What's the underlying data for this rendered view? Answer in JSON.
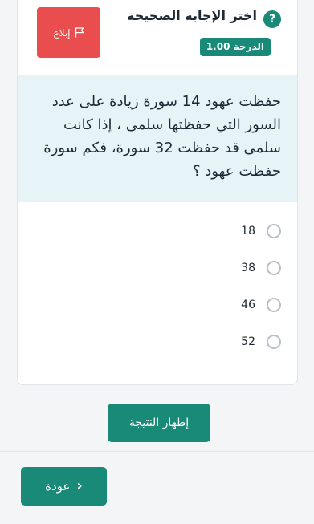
{
  "header": {
    "help_icon_glyph": "?",
    "question_type": "اختر الإجابة الصحيحة",
    "grade_badge": "الدرجة 1.00",
    "report_label": "إبلاغ"
  },
  "question": {
    "text": "حفظت عهود 14 سورة زيادة على عدد السور التي حفظتها سلمى ، إذا كانت سلمى قد حفظت 32 سورة، فكم سورة حفظت عهود ؟"
  },
  "options": [
    {
      "label": "18"
    },
    {
      "label": "38"
    },
    {
      "label": "46"
    },
    {
      "label": "52"
    }
  ],
  "actions": {
    "show_result_label": "إظهار النتيجة",
    "back_label": "عودة",
    "back_icon_glyph": "‹"
  },
  "colors": {
    "primary": "#1a8a78",
    "report": "#ea4d4d",
    "question_background": "#e6f4f7"
  }
}
